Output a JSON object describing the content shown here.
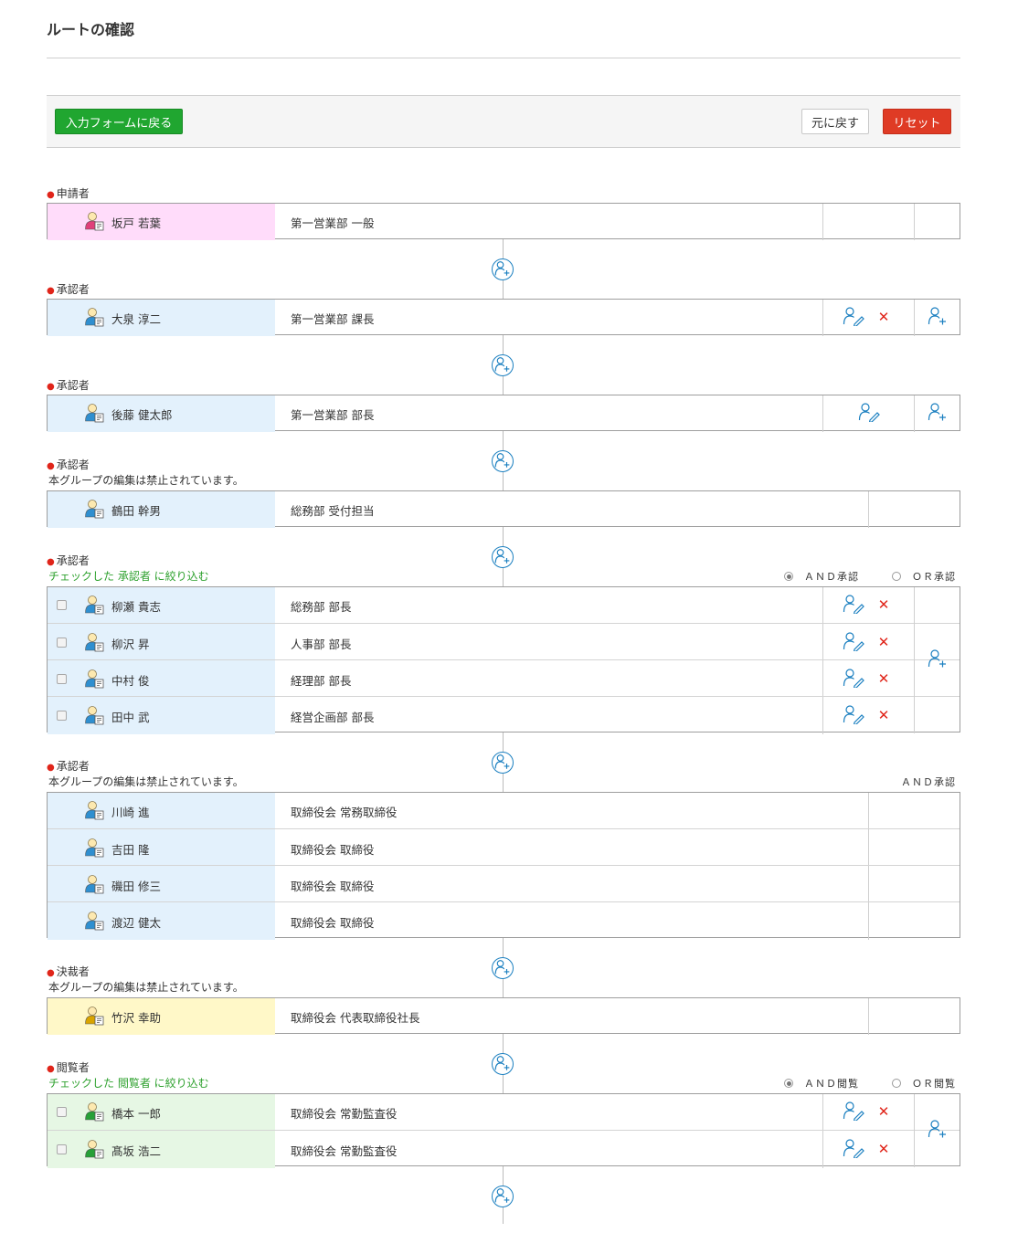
{
  "page_title": "ルートの確認",
  "toolbar": {
    "back_label": "入力フォームに戻る",
    "undo_label": "元に戻す",
    "reset_label": "リセット"
  },
  "colors": {
    "applicant": "#ffdcfa",
    "approver": "#e3f1fc",
    "decider": "#fff8c8",
    "viewer": "#e6f7e4",
    "accent_red": "#e0251a",
    "accent_green": "#20a630"
  },
  "sections": [
    {
      "label": "申請者",
      "rows": [
        {
          "name": "坂戸 若葉",
          "position": "第一営業部 一般"
        }
      ]
    },
    {
      "label": "承認者",
      "rows": [
        {
          "name": "大泉 淳二",
          "position": "第一営業部 課長"
        }
      ]
    },
    {
      "label": "承認者",
      "rows": [
        {
          "name": "後藤 健太郎",
          "position": "第一営業部 部長"
        }
      ]
    },
    {
      "label": "承認者",
      "note": "本グループの編集は禁止されています。",
      "rows": [
        {
          "name": "鶴田 幹男",
          "position": "総務部 受付担当"
        }
      ]
    },
    {
      "label": "承認者",
      "filter": "チェックした 承認者 に絞り込む",
      "and_label": "ＡＮＤ承認",
      "or_label": "ＯＲ承認",
      "rows": [
        {
          "name": "柳瀬 貴志",
          "position": "総務部 部長"
        },
        {
          "name": "柳沢 昇",
          "position": "人事部 部長"
        },
        {
          "name": "中村 俊",
          "position": "経理部 部長"
        },
        {
          "name": "田中 武",
          "position": "経営企画部 部長"
        }
      ]
    },
    {
      "label": "承認者",
      "note": "本グループの編集は禁止されています。",
      "and_label": "ＡＮＤ承認",
      "rows": [
        {
          "name": "川崎 進",
          "position": "取締役会 常務取締役"
        },
        {
          "name": "吉田 隆",
          "position": "取締役会 取締役"
        },
        {
          "name": "磯田 修三",
          "position": "取締役会 取締役"
        },
        {
          "name": "渡辺 健太",
          "position": "取締役会 取締役"
        }
      ]
    },
    {
      "label": "決裁者",
      "note": "本グループの編集は禁止されています。",
      "rows": [
        {
          "name": "竹沢 幸助",
          "position": "取締役会 代表取締役社長"
        }
      ]
    },
    {
      "label": "閲覧者",
      "filter": "チェックした 閲覧者 に絞り込む",
      "and_label": "ＡＮＤ閲覧",
      "or_label": "ＯＲ閲覧",
      "rows": [
        {
          "name": "橋本 一郎",
          "position": "取締役会 常勤監査役"
        },
        {
          "name": "髙坂 浩二",
          "position": "取締役会 常勤監査役"
        }
      ]
    }
  ],
  "icons": {
    "user": "user-icon",
    "edit": "edit-user-icon",
    "delete": "delete-icon",
    "add": "add-user-icon"
  }
}
